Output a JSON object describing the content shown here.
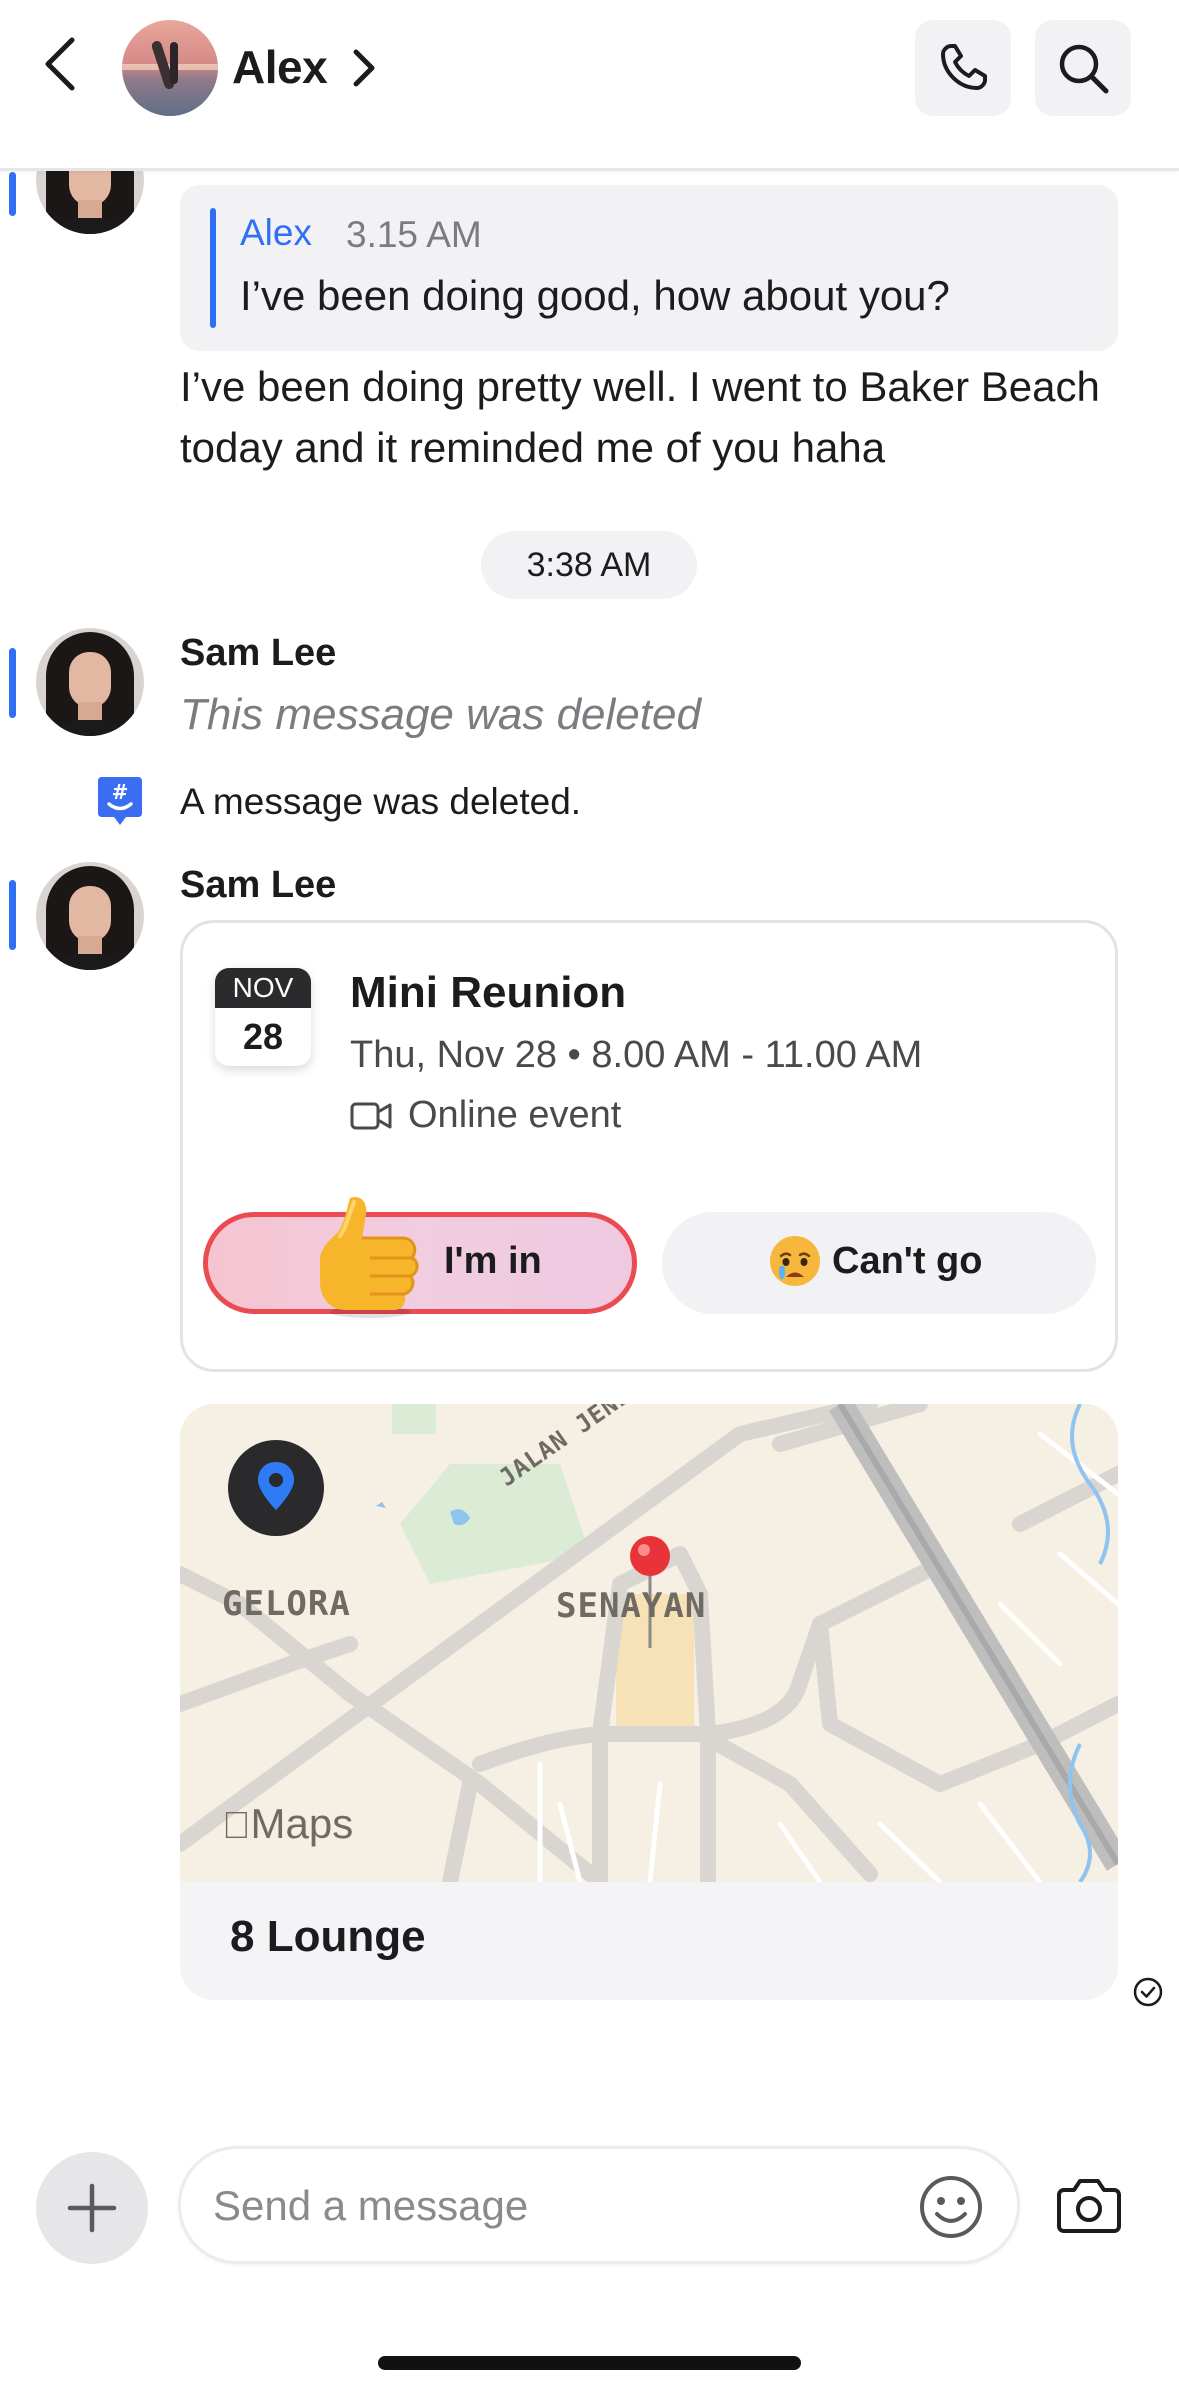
{
  "header": {
    "contact_name": "Alex",
    "icons": {
      "back": "chevron-left-icon",
      "profile": "chevron-right-icon",
      "call": "phone-icon",
      "search": "search-icon"
    }
  },
  "thread": {
    "quoted": {
      "author": "Alex",
      "time": "3.15 AM",
      "text": "I’ve been doing good, how about you?"
    },
    "reply_text": "I’ve been doing pretty well. I went to Baker Beach today and it reminded me of you haha",
    "time_divider": "3:38 AM",
    "deleted_message": {
      "sender": "Sam Lee",
      "text": "This message was deleted"
    },
    "system_notice": "A message was deleted.",
    "event_message": {
      "sender": "Sam Lee",
      "event": {
        "month": "NOV",
        "day": "28",
        "title": "Mini Reunion",
        "when": "Thu, Nov 28 • 8.00 AM - 11.00 AM",
        "where": "Online event",
        "accept_label": "I'm in",
        "decline_label": "Can't go"
      }
    },
    "location_message": {
      "map_labels": {
        "area_left": "GELORA",
        "area_center": "SENAYAN",
        "street": "JALAN JENDERAL"
      },
      "maps_brand": "Maps",
      "place_name": "8 Lounge",
      "status": "sent"
    }
  },
  "composer": {
    "placeholder": "Send a message",
    "value": ""
  },
  "colors": {
    "accent": "#2f6ff5",
    "accept_border": "#ea4b53",
    "pin": "#e8333a"
  }
}
